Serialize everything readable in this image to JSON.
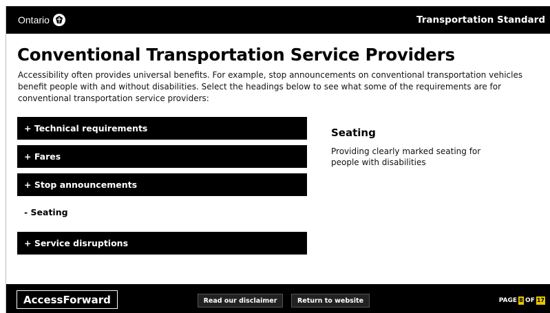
{
  "header": {
    "logo_text": "Ontario",
    "module_title": "Transportation Standard"
  },
  "main": {
    "title": "Conventional Transportation Service Providers",
    "intro": "Accessibility often provides universal benefits. For example, stop announcements on conventional transportation vehicles benefit people with and without disabilities.  Select the headings below to see what some of the requirements are for conventional transportation service providers:",
    "accordion": [
      {
        "label": "+ Technical requirements",
        "expanded": false
      },
      {
        "label": "+ Fares",
        "expanded": false
      },
      {
        "label": "+ Stop announcements",
        "expanded": false
      },
      {
        "label": "- Seating",
        "expanded": true
      },
      {
        "label": "+ Service disruptions",
        "expanded": false
      }
    ],
    "detail": {
      "title": "Seating",
      "body": "Providing clearly marked seating for people with disabilities"
    }
  },
  "footer": {
    "brand": "AccessForward",
    "disclaimer_label": "Read our disclaimer",
    "return_label": "Return to website",
    "page_label": "PAGE",
    "of_label": "OF",
    "current_page": "8",
    "total_pages": "17"
  },
  "colors": {
    "bar": "#000000",
    "page_indicator": "#e6c700"
  }
}
